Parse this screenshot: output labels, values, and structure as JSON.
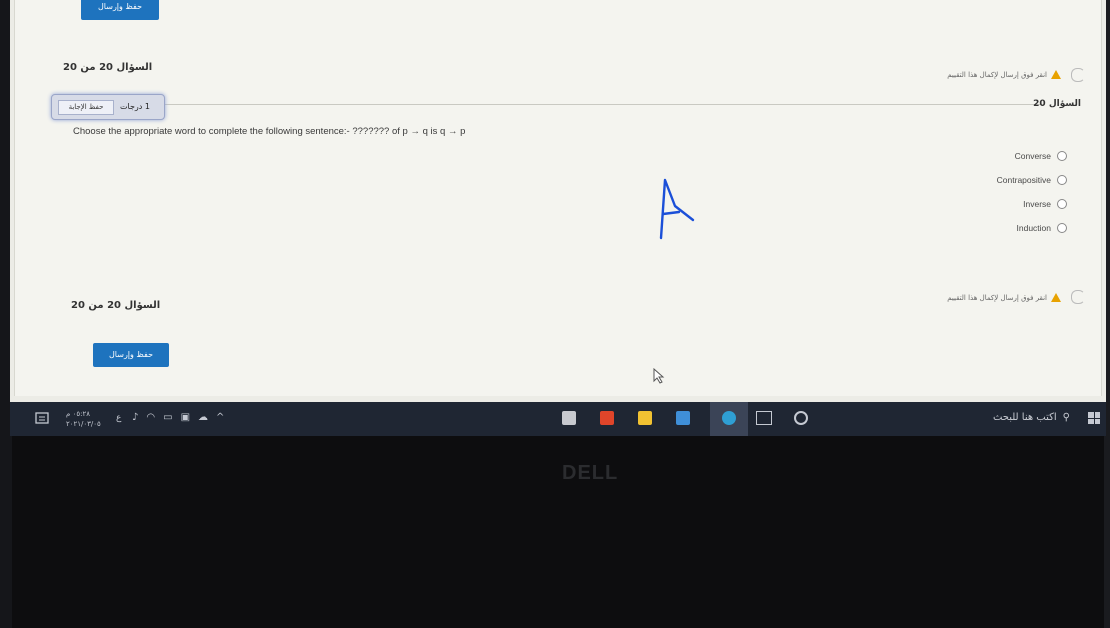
{
  "top": {
    "save_submit_label": "حفظ وإرسال"
  },
  "counter_top": "السؤال 20 من 20",
  "warning_top": "انقر فوق إرسال لإكمال هذا التقييم",
  "question_header": {
    "number_label": "السؤال 20",
    "save_answer_label": "حفظ الإجابة",
    "grade_label": "1 درجات"
  },
  "question": {
    "text": "Choose the appropriate word to complete the following sentence:- ??????? of p → q is q → p",
    "options": [
      "Converse",
      "Contrapositive",
      "Inverse",
      "Induction"
    ]
  },
  "annotation": {
    "handwritten": "A"
  },
  "warning_bottom": "انقر فوق إرسال لإكمال هذا التقييم",
  "counter_bottom": "السؤال 20 من 20",
  "bottom": {
    "save_submit_label": "حفظ وإرسال"
  },
  "taskbar": {
    "search_placeholder": "اكتب هنا للبحث",
    "time": "٠٥:٢٨ م",
    "date": "٢٠٢١/٠٣/٠٥",
    "language": "ع",
    "tray_icons": [
      "speaker-icon",
      "wifi-icon",
      "battery-icon",
      "meet-icon",
      "cloud-icon",
      "chevron-up-icon"
    ]
  },
  "brand": "DELL",
  "colors": {
    "accent": "#1e73be",
    "warning": "#e8a200",
    "taskbar": "#1f2633"
  }
}
